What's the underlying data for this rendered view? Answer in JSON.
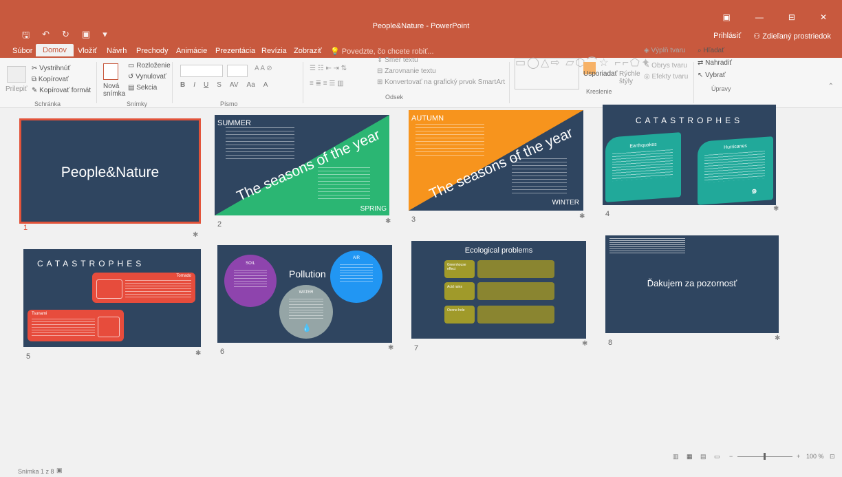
{
  "window": {
    "title": "People&Nature - PowerPoint",
    "controls": [
      "▣",
      "—",
      "⊟",
      "✕"
    ],
    "sign_in": "Prihlásiť",
    "share": "Zdieľaný prostriedok"
  },
  "tabs": [
    "Súbor",
    "Domov",
    "Vložiť",
    "Návrh",
    "Prechody",
    "Animácie",
    "Prezentácia",
    "Revízia",
    "Zobraziť"
  ],
  "tell_me": "Povedzte, čo chcete robiť...",
  "ribbon": {
    "paste": "Prilepiť",
    "cut": "Vystrihnúť",
    "copy": "Kopírovať",
    "format_painter": "Kopírovať formát",
    "clipboard": "Schránka",
    "new_slide_1": "Nová",
    "new_slide_2": "snímka",
    "layout": "Rozloženie",
    "reset": "Vynulovať",
    "section": "Sekcia",
    "slides": "Snímky",
    "font": "Písmo",
    "text_direction": "Smer textu",
    "align_text": "Zarovnanie textu",
    "convert_smartart": "Konvertovať na grafický prvok SmartArt",
    "paragraph": "Odsek",
    "arrange": "Usporiadať",
    "quick_styles_1": "Rýchle",
    "quick_styles_2": "štýly",
    "shape_fill": "Výplň tvaru",
    "shape_outline": "Obrys tvaru",
    "shape_effects": "Efekty tvaru",
    "drawing": "Kreslenie",
    "find": "Hľadať",
    "replace": "Nahradiť",
    "select": "Vybrať",
    "editing": "Úpravy"
  },
  "slides": {
    "s1": {
      "num": "1",
      "title": "People&Nature"
    },
    "s2": {
      "num": "2",
      "season_top": "SUMMER",
      "season_bottom": "SPRING",
      "banner": "The seasons of the year"
    },
    "s3": {
      "num": "3",
      "season_top": "AUTUMN",
      "season_bottom": "WINTER",
      "banner": "The seasons of the year"
    },
    "s4": {
      "num": "4",
      "title": "CATASTROPHES",
      "card1": "Earthquakes",
      "card2": "Hurricanes"
    },
    "s5": {
      "num": "5",
      "title": "CATASTROPHES",
      "box1": "Tornado",
      "box2": "Tsunami"
    },
    "s6": {
      "num": "6",
      "title": "Pollution",
      "soil": "SOIL",
      "air": "AIR",
      "water": "WATER"
    },
    "s7": {
      "num": "7",
      "title": "Ecological problems",
      "row1": "Greenhouse effect",
      "row2": "Acid rains",
      "row3": "Ozone hole"
    },
    "s8": {
      "num": "8",
      "title": "Ďakujem za pozornosť"
    }
  },
  "status": {
    "slide_info": "Snímka 1 z 8",
    "zoom": "100 %",
    "zoom_minus": "−",
    "zoom_plus": "+"
  },
  "colors": {
    "accent": "#c8593e",
    "slide_bg": "#2f4560",
    "green": "#2bb673",
    "orange": "#f7941d",
    "teal": "#21a99a",
    "red": "#e74c3c",
    "purple": "#8e44ad",
    "blue": "#2196f3",
    "olive": "#a09a2a"
  }
}
